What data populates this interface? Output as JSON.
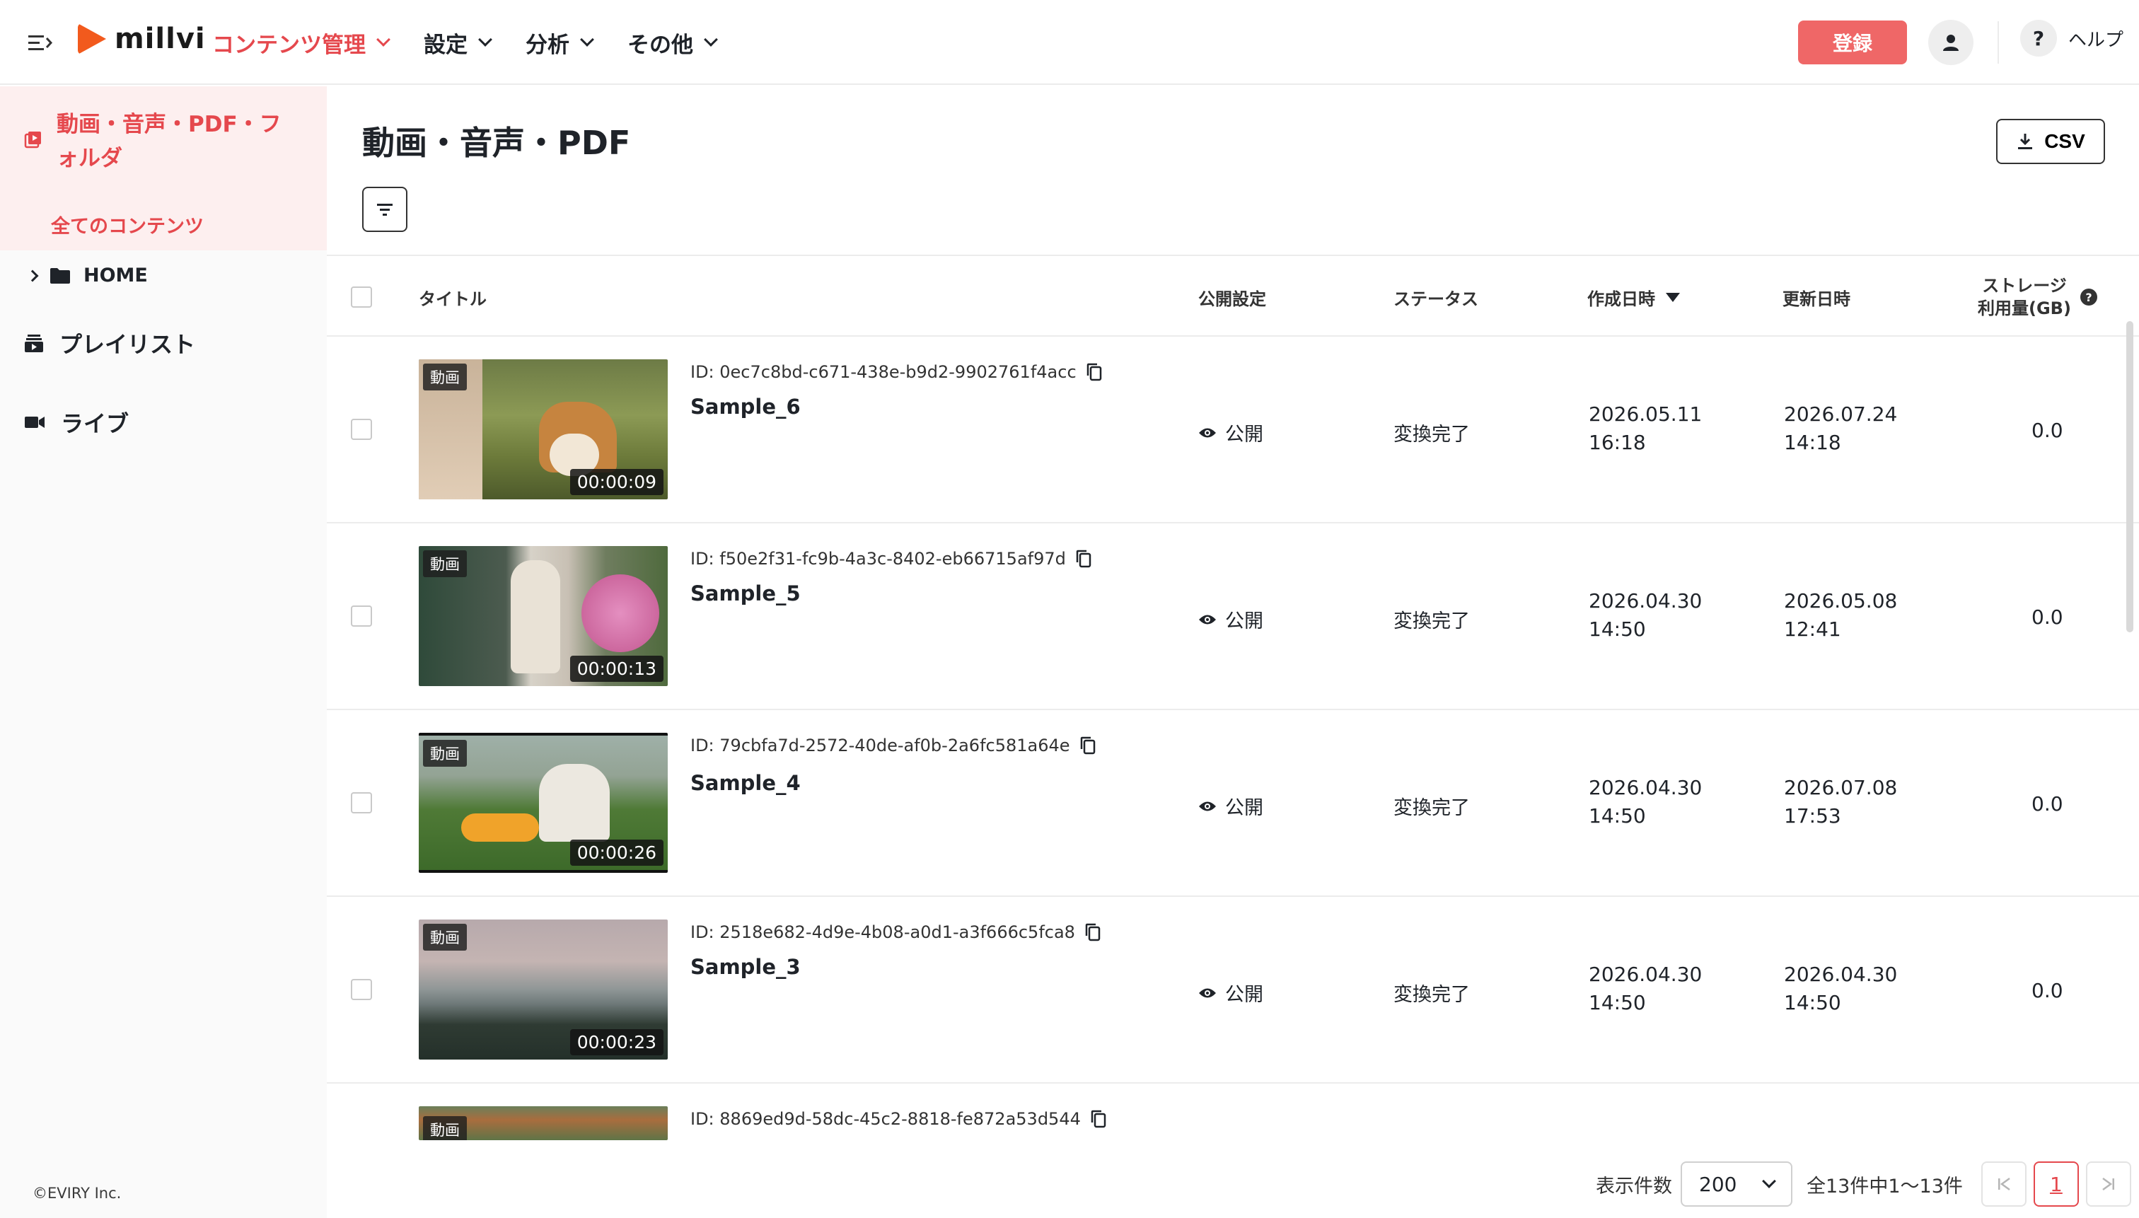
{
  "header": {
    "logo_text": "millvi",
    "nav": [
      {
        "label": "コンテンツ管理",
        "active": true
      },
      {
        "label": "設定",
        "active": false
      },
      {
        "label": "分析",
        "active": false
      },
      {
        "label": "その他",
        "active": false
      }
    ],
    "register_label": "登録",
    "help_symbol": "?",
    "help_label": "ヘルプ"
  },
  "sidebar": {
    "section_title": "動画・音声・PDF・フォルダ",
    "all_contents": "全てのコンテンツ",
    "home": "HOME",
    "playlist": "プレイリスト",
    "live": "ライブ",
    "copyright": "©EVIRY Inc."
  },
  "main": {
    "title": "動画・音声・PDF",
    "csv_label": "CSV",
    "columns": {
      "title": "タイトル",
      "visibility": "公開設定",
      "status": "ステータス",
      "created": "作成日時",
      "updated": "更新日時",
      "storage_line1": "ストレージ",
      "storage_line2": "利用量(GB)"
    },
    "rows": [
      {
        "badge": "動画",
        "duration": "00:00:09",
        "id": "ID: 0ec7c8bd-c671-438e-b9d2-9902761f4acc",
        "title": "Sample_6",
        "visibility": "公開",
        "status": "変換完了",
        "created_date": "2026.05.11",
        "created_time": "16:18",
        "updated_date": "2026.07.24",
        "updated_time": "14:18",
        "storage": "0.0"
      },
      {
        "badge": "動画",
        "duration": "00:00:13",
        "id": "ID: f50e2f31-fc9b-4a3c-8402-eb66715af97d",
        "title": "Sample_5",
        "visibility": "公開",
        "status": "変換完了",
        "created_date": "2026.04.30",
        "created_time": "14:50",
        "updated_date": "2026.05.08",
        "updated_time": "12:41",
        "storage": "0.0"
      },
      {
        "badge": "動画",
        "duration": "00:00:26",
        "id": "ID: 79cbfa7d-2572-40de-af0b-2a6fc581a64e",
        "title": "Sample_4",
        "visibility": "公開",
        "status": "変換完了",
        "created_date": "2026.04.30",
        "created_time": "14:50",
        "updated_date": "2026.07.08",
        "updated_time": "17:53",
        "storage": "0.0"
      },
      {
        "badge": "動画",
        "duration": "00:00:23",
        "id": "ID: 2518e682-4d9e-4b08-a0d1-a3f666c5fca8",
        "title": "Sample_3",
        "visibility": "公開",
        "status": "変換完了",
        "created_date": "2026.04.30",
        "created_time": "14:50",
        "updated_date": "2026.04.30",
        "updated_time": "14:50",
        "storage": "0.0"
      },
      {
        "badge": "動画",
        "id": "ID: 8869ed9d-58dc-45c2-8818-fe872a53d544"
      }
    ]
  },
  "pagination": {
    "per_page_label": "表示件数",
    "per_page_value": "200",
    "count_text": "全13件中1〜13件",
    "current_page": "1"
  },
  "colors": {
    "accent": "#e5484d",
    "register": "#ef6767",
    "sidebar_active_bg": "#fdefef",
    "logo": "#f25a1d"
  }
}
